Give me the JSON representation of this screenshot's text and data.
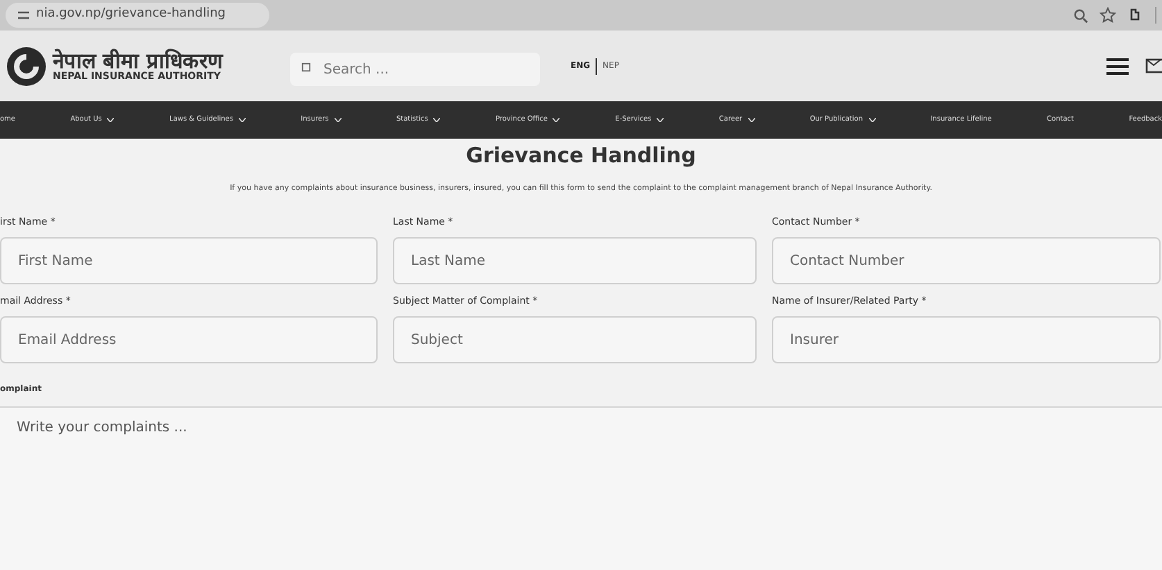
{
  "browser": {
    "url": "nia.gov.np/grievance-handling"
  },
  "header": {
    "logo_title": "नेपाल बीमा प्राधिकरण",
    "logo_subtitle": "NEPAL INSURANCE AUTHORITY",
    "search": {
      "placeholder": "Search ..."
    },
    "languages": [
      {
        "label": "ENG",
        "selected": true
      },
      {
        "label": "NEP",
        "selected": false
      }
    ]
  },
  "nav": [
    {
      "label": "ome",
      "dropdown": false
    },
    {
      "label": "About Us",
      "dropdown": true
    },
    {
      "label": "Laws & Guidelines",
      "dropdown": true
    },
    {
      "label": "Insurers",
      "dropdown": true
    },
    {
      "label": "Statistics",
      "dropdown": true
    },
    {
      "label": "Province Office",
      "dropdown": true
    },
    {
      "label": "E-Services",
      "dropdown": true
    },
    {
      "label": "Career",
      "dropdown": true
    },
    {
      "label": "Our Publication",
      "dropdown": true
    },
    {
      "label": "Insurance Lifeline",
      "dropdown": false
    },
    {
      "label": "Contact",
      "dropdown": false
    },
    {
      "label": "Feedback",
      "dropdown": false
    }
  ],
  "page": {
    "title": "Grievance Handling",
    "intro": "If you have any complaints about insurance business, insurers, insured, you can fill this form to send the complaint to the complaint management branch of Nepal Insurance Authority."
  },
  "fields": [
    {
      "label": "irst Name *",
      "placeholder": "First Name"
    },
    {
      "label": "Last Name *",
      "placeholder": "Last Name"
    },
    {
      "label": "Contact Number *",
      "placeholder": "Contact Number"
    },
    {
      "label": "mail Address *",
      "placeholder": "Email Address"
    },
    {
      "label": "Subject Matter of Complaint *",
      "placeholder": "Subject"
    },
    {
      "label": "Name of Insurer/Related Party *",
      "placeholder": "Insurer"
    }
  ],
  "complaint": {
    "label": "omplaint",
    "placeholder": "Write your complaints ..."
  }
}
